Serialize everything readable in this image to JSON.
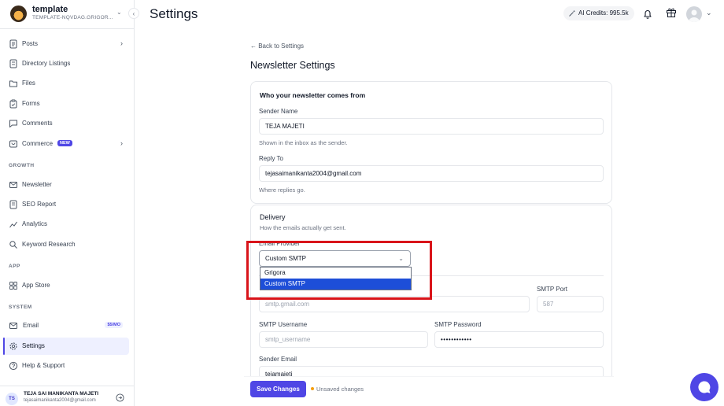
{
  "workspace": {
    "name": "template",
    "subtitle": "TEMPLATE-NQVDAG.GRIGOR..."
  },
  "sidebar": {
    "items": [
      {
        "label": "Posts",
        "icon": "document-icon",
        "arrow": "›"
      },
      {
        "label": "Directory Listings",
        "icon": "list-icon"
      },
      {
        "label": "Files",
        "icon": "folder-icon"
      },
      {
        "label": "Forms",
        "icon": "clipboard-icon"
      },
      {
        "label": "Comments",
        "icon": "comment-icon"
      },
      {
        "label": "Commerce",
        "icon": "cart-icon",
        "badge": "NEW",
        "arrow": "›"
      }
    ],
    "growth_title": "GROWTH",
    "growth": [
      {
        "label": "Newsletter",
        "icon": "mail-icon"
      },
      {
        "label": "SEO Report",
        "icon": "report-icon"
      },
      {
        "label": "Analytics",
        "icon": "chart-line-icon"
      },
      {
        "label": "Keyword Research",
        "icon": "search-icon"
      }
    ],
    "app_title": "APP",
    "app": [
      {
        "label": "App Store",
        "icon": "grid-icon"
      }
    ],
    "system_title": "SYSTEM",
    "system": [
      {
        "label": "Email",
        "icon": "mail-icon",
        "badge": "$5/MO"
      },
      {
        "label": "Settings",
        "icon": "gear-icon"
      },
      {
        "label": "Help & Support",
        "icon": "help-icon"
      }
    ]
  },
  "user": {
    "initials": "TS",
    "name": "TEJA SAI MANIKANTA MAJETI",
    "email": "tejasaimanikanta2004@gmail.com"
  },
  "header": {
    "title": "Settings",
    "credits": "AI Credits: 995.5k"
  },
  "main": {
    "back_link": "← Back to Settings",
    "title": "Newsletter Settings",
    "sender_card": {
      "title": "Who your newsletter comes from",
      "sender_name_label": "Sender Name",
      "sender_name_value": "TEJA MAJETI",
      "sender_name_help": "Shown in the inbox as the sender.",
      "reply_to_label": "Reply To",
      "reply_to_value": "tejasaimanikanta2004@gmail.com",
      "reply_to_help": "Where replies go."
    },
    "delivery": {
      "title": "Delivery",
      "subtitle": "How the emails actually get sent.",
      "provider_label": "Email Provider",
      "provider_value": "Custom SMTP",
      "provider_options": [
        "Grigora",
        "Custom SMTP"
      ],
      "smtp_port_label": "SMTP Port",
      "smtp_host_placeholder": "smtp.gmail.com",
      "smtp_port_placeholder": "587",
      "smtp_username_label": "SMTP Username",
      "smtp_username_placeholder": "smtp_username",
      "smtp_password_label": "SMTP Password",
      "smtp_password_value": "••••••••••••",
      "sender_email_label": "Sender Email",
      "sender_email_value": "tejamajeti"
    }
  },
  "footer": {
    "save_label": "Save Changes",
    "unsaved_label": "Unsaved changes"
  },
  "colors": {
    "accent": "#4f46e5",
    "highlight": "#d9141a",
    "selected_option": "#1d4ed8"
  }
}
